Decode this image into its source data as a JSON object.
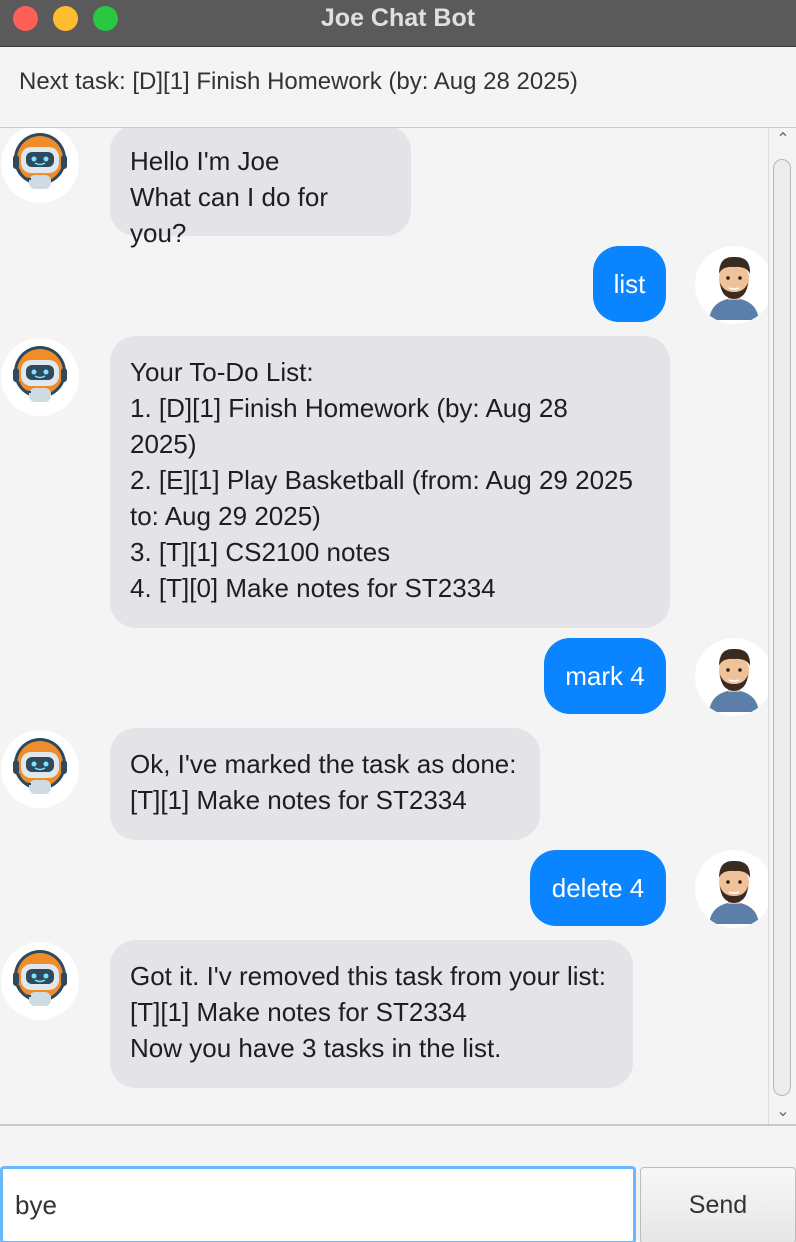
{
  "window": {
    "title": "Joe Chat Bot"
  },
  "header": {
    "next_task": "Next task: [D][1] Finish Homework (by: Aug 28 2025)"
  },
  "messages": [
    {
      "sender": "bot",
      "avatar_icon": "robot-avatar-icon",
      "text": "Hello I'm Joe\nWhat can I do for you?"
    },
    {
      "sender": "user",
      "avatar_icon": "user-avatar-icon",
      "text": "list"
    },
    {
      "sender": "bot",
      "avatar_icon": "robot-avatar-icon",
      "text": "Your To-Do List:\n1. [D][1] Finish Homework (by: Aug 28\n2025)\n2. [E][1] Play Basketball (from: Aug 29 2025\nto: Aug 29 2025)\n3. [T][1] CS2100 notes\n4. [T][0] Make notes for ST2334"
    },
    {
      "sender": "user",
      "avatar_icon": "user-avatar-icon",
      "text": "mark 4"
    },
    {
      "sender": "bot",
      "avatar_icon": "robot-avatar-icon",
      "text": "Ok, I've marked the task as done:\n[T][1] Make notes for ST2334"
    },
    {
      "sender": "user",
      "avatar_icon": "user-avatar-icon",
      "text": "delete 4"
    },
    {
      "sender": "bot",
      "avatar_icon": "robot-avatar-icon",
      "text": "Got it. I'v removed this task from your list:\n[T][1] Make notes for ST2334\nNow you have 3 tasks in the list."
    }
  ],
  "input": {
    "value": "bye"
  },
  "send_button": {
    "label": "Send"
  },
  "colors": {
    "user_bubble": "#0a84ff",
    "bot_bubble": "#e3e3e8",
    "titlebar": "#5a5a5a",
    "input_focus": "#6ab7ff"
  }
}
